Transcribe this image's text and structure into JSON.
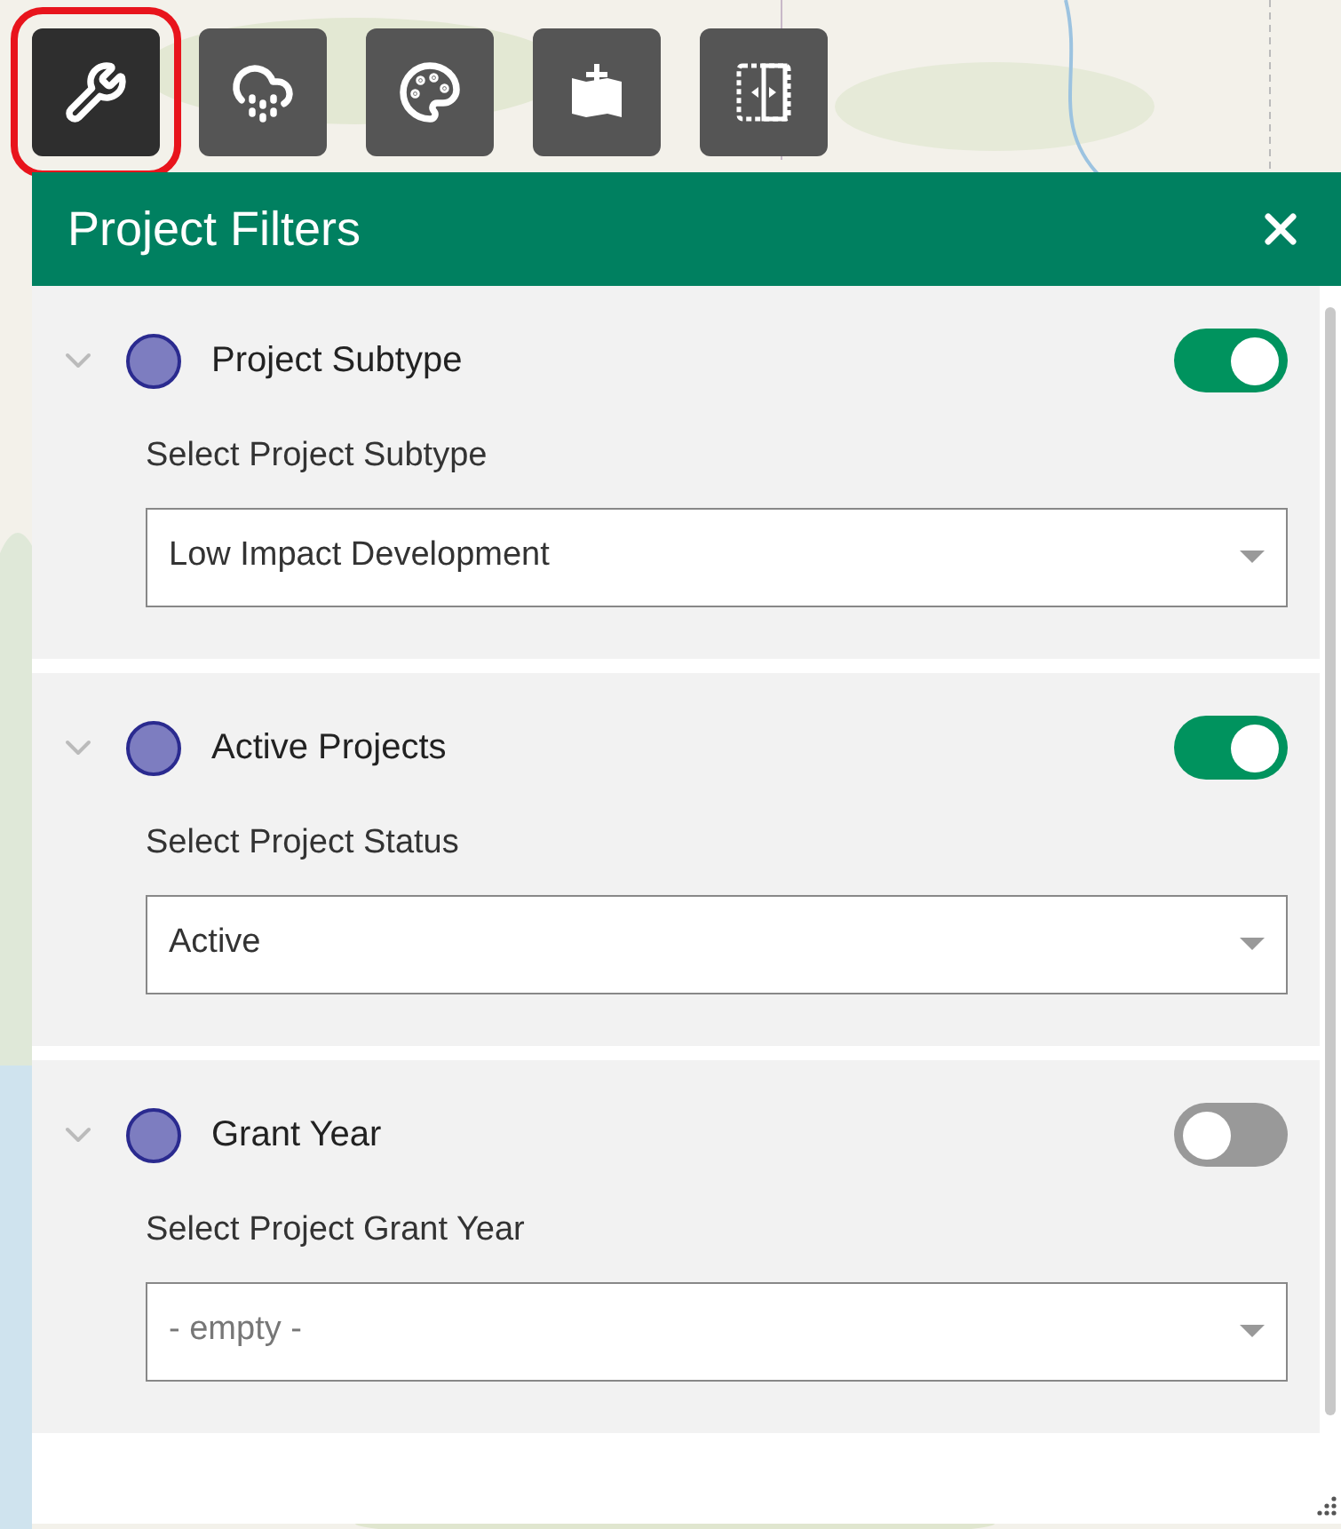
{
  "toolbar": [
    {
      "kind": "wrench",
      "selected": true
    },
    {
      "kind": "rain",
      "selected": false
    },
    {
      "kind": "palette",
      "selected": false
    },
    {
      "kind": "add-map",
      "selected": false
    },
    {
      "kind": "split",
      "selected": false
    }
  ],
  "panel": {
    "title": "Project Filters",
    "filters": [
      {
        "title": "Project Subtype",
        "on": true,
        "label": "Select Project Subtype",
        "value": "Low Impact Development"
      },
      {
        "title": "Active Projects",
        "on": true,
        "label": "Select Project Status",
        "value": "Active"
      },
      {
        "title": "Grant Year",
        "on": false,
        "label": "Select Project Grant Year",
        "placeholder": "- empty -"
      }
    ]
  }
}
